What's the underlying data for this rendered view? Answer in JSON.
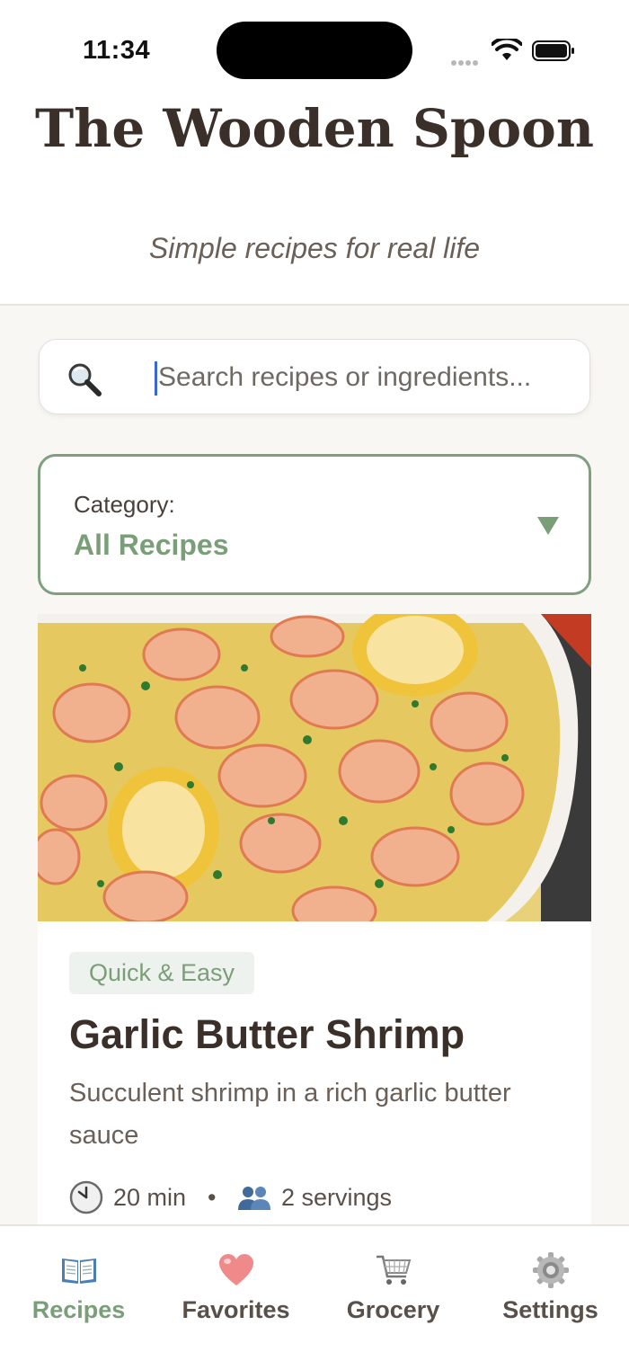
{
  "status_bar": {
    "time": "11:34"
  },
  "header": {
    "title": "The Wooden Spoon",
    "tagline": "Simple recipes for real life"
  },
  "search": {
    "placeholder": "Search recipes or ingredients...",
    "value": "",
    "icon": "magnifying-glass"
  },
  "category": {
    "label": "Category:",
    "selected": "All Recipes",
    "icon": "triangle-down"
  },
  "recipe": {
    "image": "garlic butter shrimp in white pan with lemon slices and parsley",
    "tag": "Quick & Easy",
    "title": "Garlic Butter Shrimp",
    "description": "Succulent shrimp in a rich garlic butter sauce",
    "time": "20 min",
    "separator": "•",
    "servings": "2 servings"
  },
  "tabs": [
    {
      "label": "Recipes",
      "icon": "book",
      "active": true
    },
    {
      "label": "Favorites",
      "icon": "heart",
      "active": false
    },
    {
      "label": "Grocery",
      "icon": "cart",
      "active": false
    },
    {
      "label": "Settings",
      "icon": "gear",
      "active": false
    }
  ],
  "colors": {
    "accent_green": "#7a9f78",
    "title_brown": "#3a2f29",
    "background": "#f8f7f4"
  }
}
